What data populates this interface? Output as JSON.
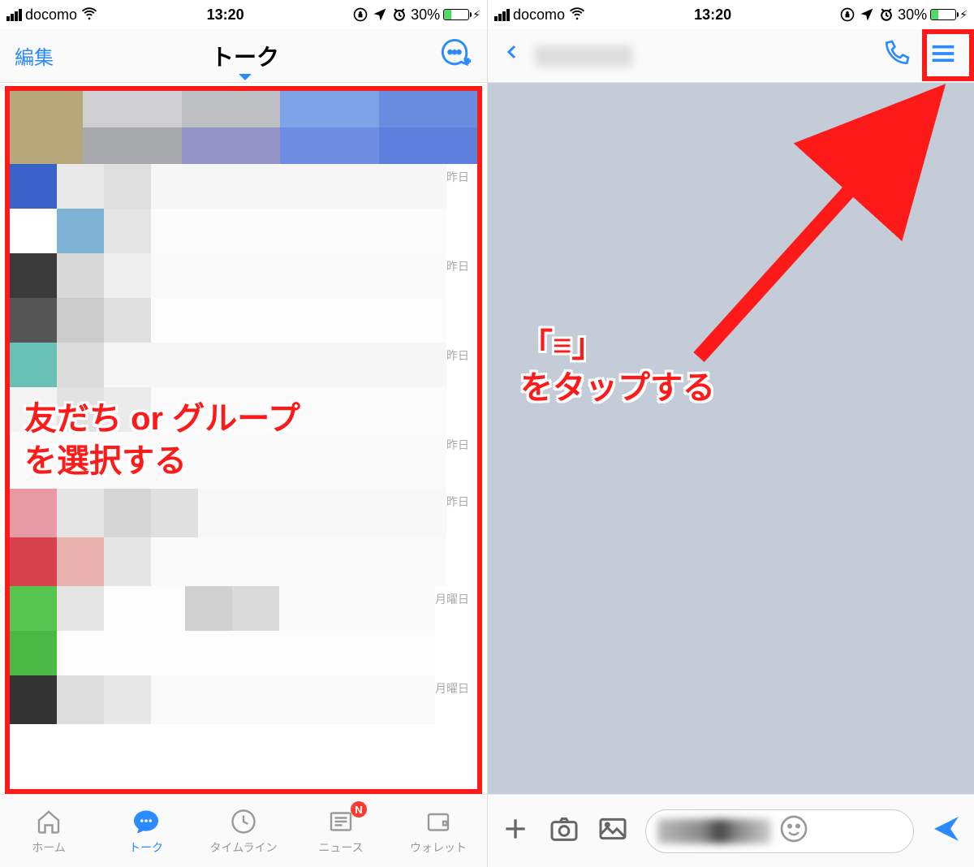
{
  "status": {
    "carrier": "docomo",
    "time": "13:20",
    "battery_pct": "30%"
  },
  "left": {
    "edit": "編集",
    "title": "トーク",
    "timestamps": [
      "",
      "昨日",
      "昨日",
      "昨日",
      "昨日",
      "昨日",
      "月曜日",
      "月曜日"
    ],
    "tabs": {
      "home": "ホーム",
      "talk": "トーク",
      "timeline": "タイムライン",
      "news": "ニュース",
      "wallet": "ウォレット",
      "news_badge": "N"
    },
    "annotation": "友だち or グループ\nを選択する"
  },
  "right": {
    "annotation": "「≡」\nをタップする"
  }
}
